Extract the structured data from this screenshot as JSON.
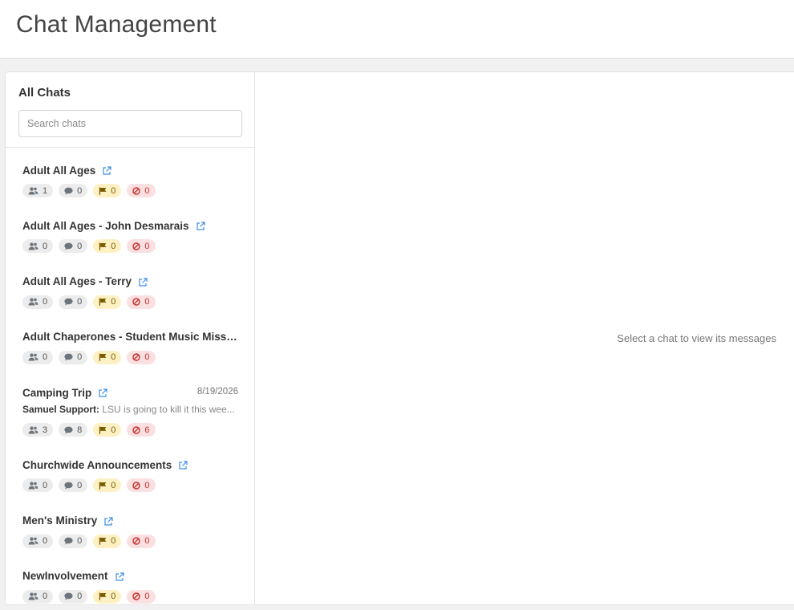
{
  "header": {
    "title": "Chat Management"
  },
  "sidebar": {
    "title": "All Chats",
    "search": {
      "placeholder": "Search chats",
      "value": ""
    }
  },
  "chats": [
    {
      "name": "Adult All Ages",
      "date": "",
      "sender": "",
      "preview": "",
      "members": "1",
      "messages": "0",
      "flagged": "0",
      "blocked": "0"
    },
    {
      "name": "Adult All Ages - John Desmarais",
      "date": "",
      "sender": "",
      "preview": "",
      "members": "0",
      "messages": "0",
      "flagged": "0",
      "blocked": "0"
    },
    {
      "name": "Adult All Ages - Terry",
      "date": "",
      "sender": "",
      "preview": "",
      "members": "0",
      "messages": "0",
      "flagged": "0",
      "blocked": "0"
    },
    {
      "name": "Adult Chaperones - Student Music Missio...",
      "date": "",
      "sender": "",
      "preview": "",
      "members": "0",
      "messages": "0",
      "flagged": "0",
      "blocked": "0"
    },
    {
      "name": "Camping Trip",
      "date": "8/19/2026",
      "sender": "Samuel Support:",
      "preview": "LSU is going to kill it this wee...",
      "members": "3",
      "messages": "8",
      "flagged": "0",
      "blocked": "6"
    },
    {
      "name": "Churchwide Announcements",
      "date": "",
      "sender": "",
      "preview": "",
      "members": "0",
      "messages": "0",
      "flagged": "0",
      "blocked": "0"
    },
    {
      "name": "Men's Ministry",
      "date": "",
      "sender": "",
      "preview": "",
      "members": "0",
      "messages": "0",
      "flagged": "0",
      "blocked": "0"
    },
    {
      "name": "NewInvolvement",
      "date": "",
      "sender": "",
      "preview": "",
      "members": "0",
      "messages": "0",
      "flagged": "0",
      "blocked": "0"
    }
  ],
  "main": {
    "empty_text": "Select a chat to view its messages"
  },
  "colors": {
    "link": "#3d8ee6",
    "flag": "#7a5b00",
    "blocked": "#c9302c"
  },
  "icons": {
    "members": "users-icon",
    "messages": "comment-icon",
    "flagged": "flag-icon",
    "blocked": "ban-icon",
    "link": "external-link-icon"
  }
}
